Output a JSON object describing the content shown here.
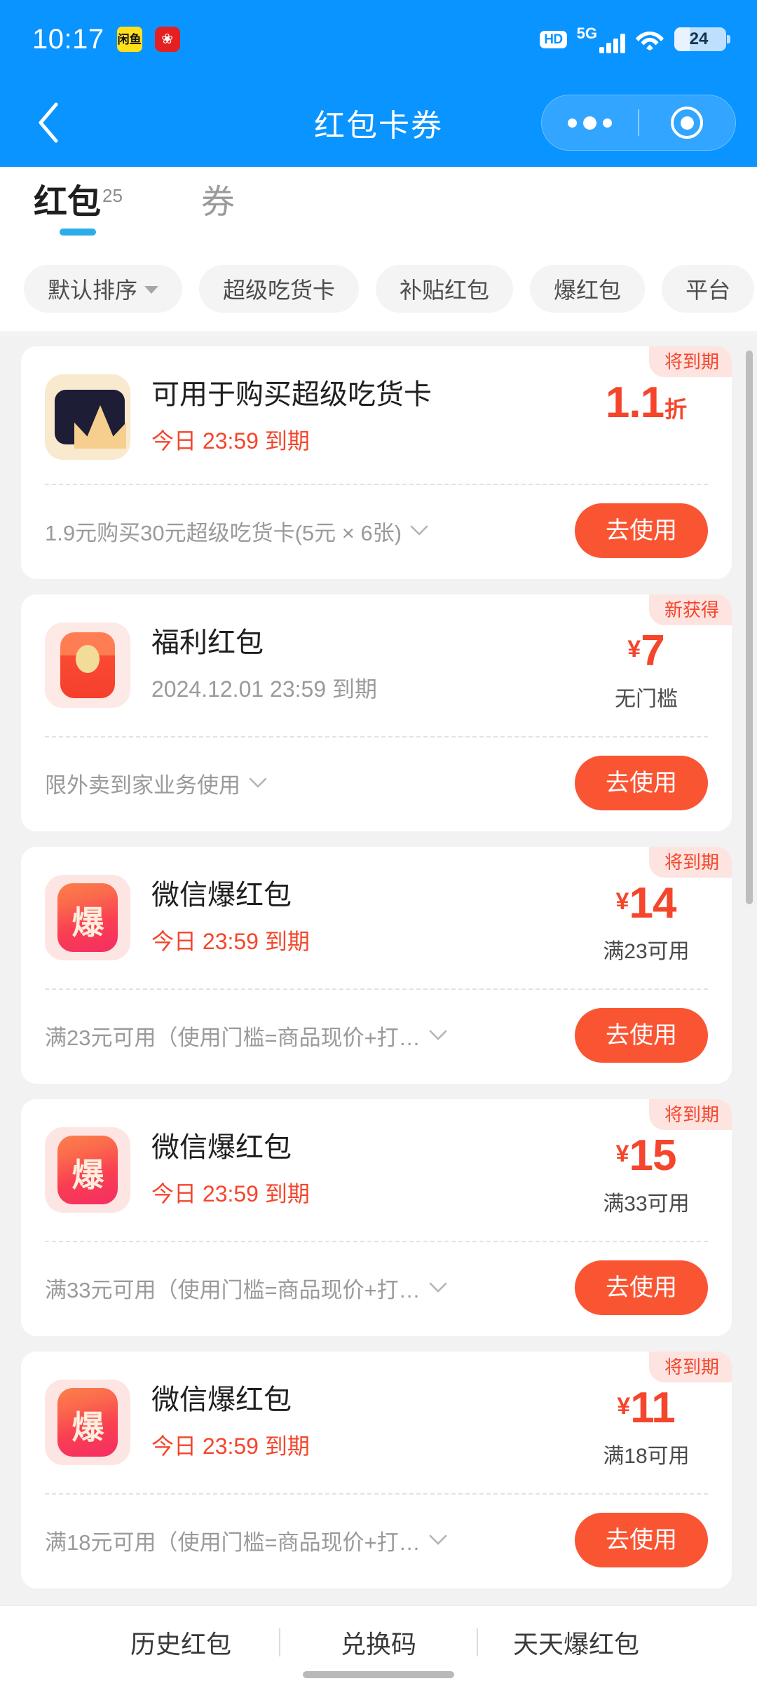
{
  "status_bar": {
    "time": "10:17",
    "app_icon_1": "yellow-app-icon",
    "app_icon_1_glyph": "闲鱼",
    "app_icon_2": "red-app-icon",
    "app_icon_2_glyph": "❀",
    "hd_label": "HD",
    "network_label": "5G",
    "wifi_icon": "wifi-icon",
    "battery_percent": "24"
  },
  "nav": {
    "back_icon": "back-chevron-icon",
    "title": "红包卡券",
    "more_icon": "more-dots-icon",
    "target_icon": "target-circle-icon"
  },
  "tabs": [
    {
      "label": "红包",
      "count": "25",
      "active": true
    },
    {
      "label": "券",
      "count": "",
      "active": false
    }
  ],
  "filters": [
    {
      "label": "默认排序",
      "has_caret": true
    },
    {
      "label": "超级吃货卡",
      "has_caret": false
    },
    {
      "label": "补贴红包",
      "has_caret": false
    },
    {
      "label": "爆红包",
      "has_caret": false
    },
    {
      "label": "平台",
      "has_caret": false
    }
  ],
  "cards": [
    {
      "badge": "将到期",
      "icon": "crown-card-icon",
      "title": "可用于购买超级吃货卡",
      "expiry": "今日 23:59 到期",
      "expiry_soon": true,
      "amount_yen": "",
      "amount_value": "1.1",
      "amount_suffix": "折",
      "condition": "",
      "description": "1.9元购买30元超级吃货卡(5元 × 6张)",
      "action": "去使用"
    },
    {
      "badge": "新获得",
      "icon": "red-packet-icon",
      "title": "福利红包",
      "expiry": "2024.12.01 23:59 到期",
      "expiry_soon": false,
      "amount_yen": "¥",
      "amount_value": "7",
      "amount_suffix": "",
      "condition": "无门槛",
      "description": "限外卖到家业务使用",
      "action": "去使用"
    },
    {
      "badge": "将到期",
      "icon": "bao-packet-icon",
      "title": "微信爆红包",
      "expiry": "今日 23:59 到期",
      "expiry_soon": true,
      "amount_yen": "¥",
      "amount_value": "14",
      "amount_suffix": "",
      "condition": "满23可用",
      "description": "满23元可用（使用门槛=商品现价+打…",
      "action": "去使用"
    },
    {
      "badge": "将到期",
      "icon": "bao-packet-icon",
      "title": "微信爆红包",
      "expiry": "今日 23:59 到期",
      "expiry_soon": true,
      "amount_yen": "¥",
      "amount_value": "15",
      "amount_suffix": "",
      "condition": "满33可用",
      "description": "满33元可用（使用门槛=商品现价+打…",
      "action": "去使用"
    },
    {
      "badge": "将到期",
      "icon": "bao-packet-icon",
      "title": "微信爆红包",
      "expiry": "今日 23:59 到期",
      "expiry_soon": true,
      "amount_yen": "¥",
      "amount_value": "11",
      "amount_suffix": "",
      "condition": "满18可用",
      "description": "满18元可用（使用门槛=商品现价+打…",
      "action": "去使用"
    }
  ],
  "bottom_bar": [
    {
      "label": "历史红包"
    },
    {
      "label": "兑换码"
    },
    {
      "label": "天天爆红包"
    }
  ],
  "icon_glyphs": {
    "bao": "爆"
  },
  "colors": {
    "brand_blue": "#0a94ff",
    "accent_red": "#f5452c",
    "button_orange": "#fa5533",
    "tab_underline": "#2dade8",
    "badge_bg": "#fde4e0"
  }
}
